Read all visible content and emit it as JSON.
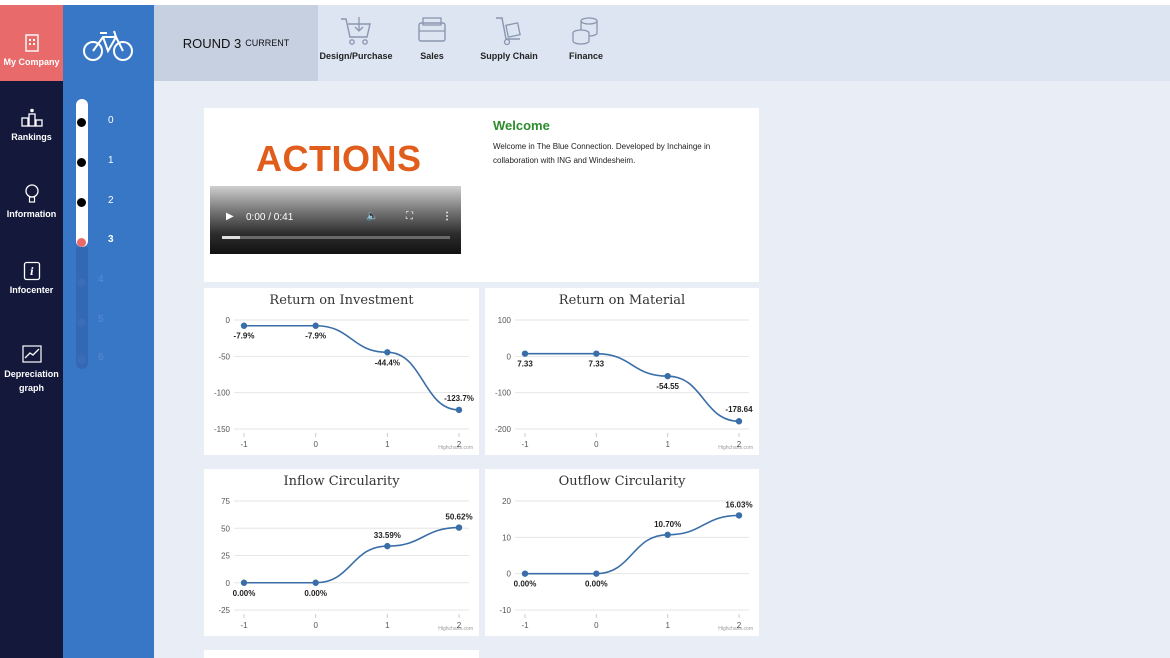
{
  "nav": {
    "items": [
      {
        "label": "My Company",
        "icon": "company-icon"
      },
      {
        "label": "Rankings",
        "icon": "podium-icon"
      },
      {
        "label": "Information",
        "icon": "lightbulb-icon"
      },
      {
        "label": "Infocenter",
        "icon": "info-icon"
      },
      {
        "label": "Depreciation graph",
        "icon": "line-graph-icon"
      }
    ]
  },
  "rounds": {
    "icon": "bicycle-icon",
    "items": [
      "0",
      "1",
      "2",
      "3",
      "4",
      "5",
      "6"
    ],
    "current": "3"
  },
  "topbar": {
    "round_label": "ROUND 3",
    "round_sub": "CURRENT",
    "tabs": [
      {
        "label": "Design/Purchase",
        "icon": "cart-icon"
      },
      {
        "label": "Sales",
        "icon": "cash-register-icon"
      },
      {
        "label": "Supply Chain",
        "icon": "hand-truck-icon"
      },
      {
        "label": "Finance",
        "icon": "coins-icon"
      }
    ]
  },
  "welcome": {
    "actions_title": "ACTIONS",
    "video_time": "0:00 / 0:41",
    "video_progress": 0.08,
    "heading": "Welcome",
    "text": "Welcome in The Blue Connection. Developed by Inchainge in collaboration with ING and Windesheim."
  },
  "colors": {
    "accent": "#e86a6a",
    "nav_bg": "#14183a",
    "rounds_bg": "#3877c6",
    "line": "#3a6ea8",
    "actions": "#e05d1c",
    "welcome": "#2d8c2d"
  },
  "chart_data": [
    {
      "type": "line",
      "title": "Return on Investment",
      "x": [
        -1,
        0,
        1,
        2
      ],
      "xticks": [
        "-1",
        "0",
        "1",
        "2"
      ],
      "values": [
        -7.9,
        -7.9,
        -44.4,
        -123.7
      ],
      "labels": [
        "-7.9%",
        "-7.9%",
        "-44.4%",
        "-123.7%"
      ],
      "yticks": [
        0,
        -50,
        -100,
        -150
      ],
      "ylim": [
        -150,
        0
      ],
      "credit": "Highcharts.com"
    },
    {
      "type": "line",
      "title": "Return on Material",
      "x": [
        -1,
        0,
        1,
        2
      ],
      "xticks": [
        "-1",
        "0",
        "1",
        "2"
      ],
      "values": [
        7.33,
        7.33,
        -54.55,
        -178.64
      ],
      "labels": [
        "7.33",
        "7.33",
        "-54.55",
        "-178.64"
      ],
      "yticks": [
        100,
        0,
        -100,
        -200
      ],
      "ylim": [
        -200,
        100
      ],
      "credit": "Highcharts.com"
    },
    {
      "type": "line",
      "title": "Inflow Circularity",
      "x": [
        -1,
        0,
        1,
        2
      ],
      "xticks": [
        "-1",
        "0",
        "1",
        "2"
      ],
      "values": [
        0,
        0,
        33.59,
        50.62
      ],
      "labels": [
        "0.00%",
        "0.00%",
        "33.59%",
        "50.62%"
      ],
      "yticks": [
        75,
        50,
        25,
        0,
        -25
      ],
      "ylim": [
        -25,
        75
      ],
      "credit": "Highcharts.com"
    },
    {
      "type": "line",
      "title": "Outflow Circularity",
      "x": [
        -1,
        0,
        1,
        2
      ],
      "xticks": [
        "-1",
        "0",
        "1",
        "2"
      ],
      "values": [
        0,
        0,
        10.7,
        16.03
      ],
      "labels": [
        "0.00%",
        "0.00%",
        "10.70%",
        "16.03%"
      ],
      "yticks": [
        20,
        10,
        0,
        -10
      ],
      "ylim": [
        -10,
        20
      ],
      "credit": "Highcharts.com"
    }
  ]
}
